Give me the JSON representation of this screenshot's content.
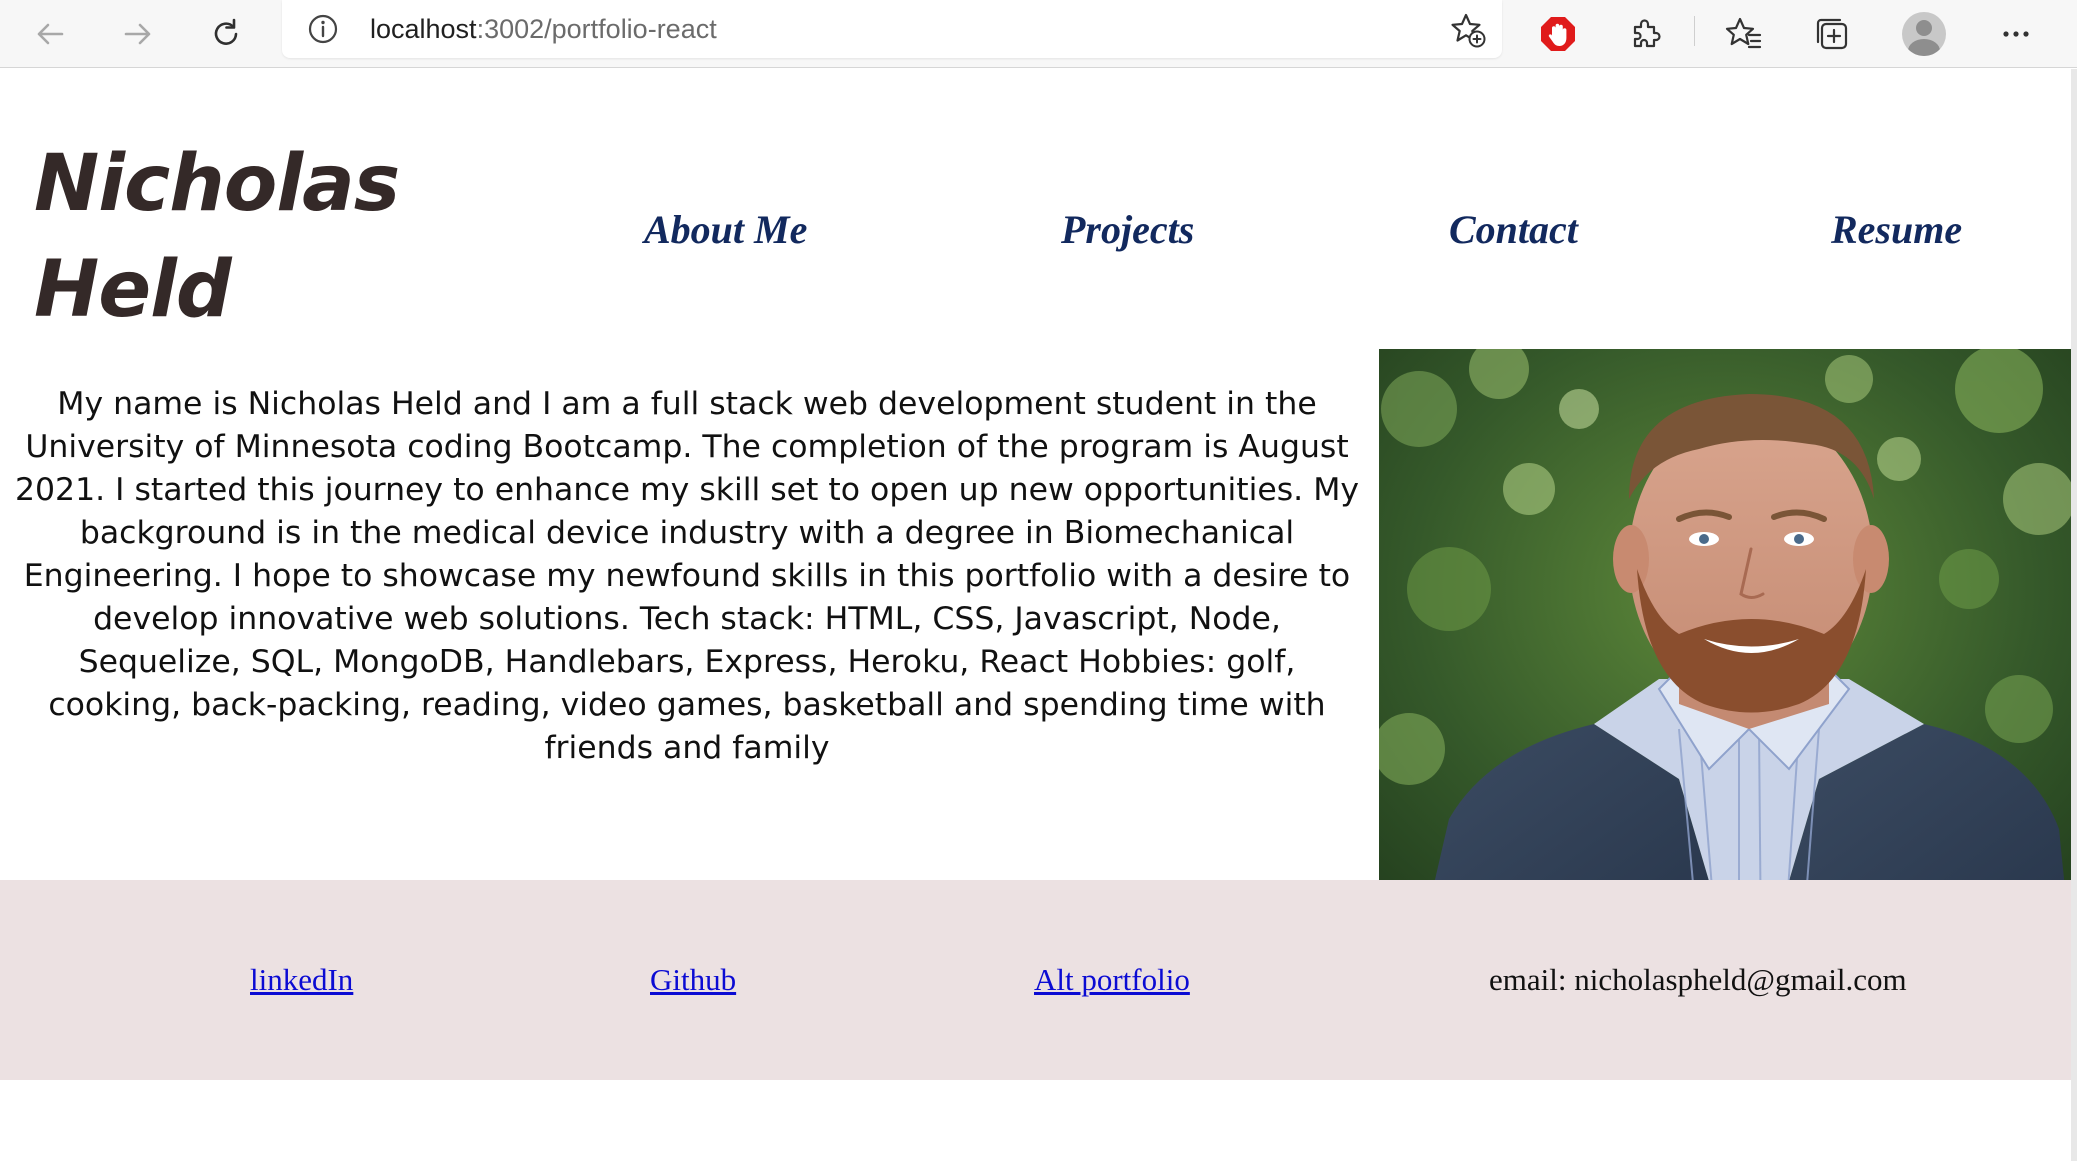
{
  "browser": {
    "url_host": "localhost",
    "url_path": ":3002/portfolio-react",
    "icons": [
      "back-arrow-icon",
      "forward-arrow-icon",
      "reload-icon",
      "info-icon",
      "add-favorite-icon",
      "adblock-icon",
      "extensions-icon",
      "favorites-icon",
      "collections-icon",
      "profile-avatar-icon",
      "more-menu-icon"
    ]
  },
  "header": {
    "title_line1": "Nicholas",
    "title_line2": "Held",
    "nav": [
      {
        "label": "About Me"
      },
      {
        "label": "Projects"
      },
      {
        "label": "Contact"
      },
      {
        "label": "Resume"
      }
    ]
  },
  "about": {
    "bio": "My name is Nicholas Held and I am a full stack web development student in the University of Minnesota coding Bootcamp. The completion of the program is August 2021. I started this journey to enhance my skill set to open up new opportunities. My background is in the medical device industry with a degree in Biomechanical Engineering. I hope to showcase my newfound skills in this portfolio with a desire to develop innovative web solutions. Tech stack: HTML, CSS, Javascript, Node, Sequelize, SQL, MongoDB, Handlebars, Express, Heroku, React Hobbies: golf, cooking, back-packing, reading, video games, basketball and spending time with friends and family"
  },
  "footer": {
    "linkedin_label": "linkedIn",
    "github_label": "Github",
    "alt_portfolio_label": "Alt portfolio",
    "email_text": "email: nicholaspheld@gmail.com"
  },
  "colors": {
    "title": "#342928",
    "nav": "#12295e",
    "footer_bg": "#ece1e2",
    "link": "#0b0bd3"
  }
}
